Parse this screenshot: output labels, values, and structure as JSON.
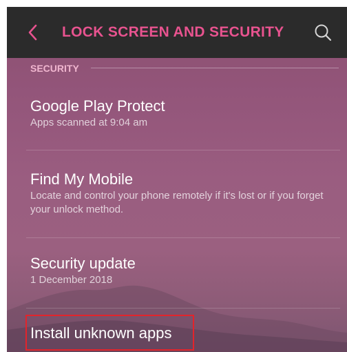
{
  "header": {
    "back_label": "<",
    "title": "LOCK SCREEN AND SECURITY"
  },
  "section": {
    "label": "SECURITY"
  },
  "items": [
    {
      "title": "Google Play Protect",
      "subtitle": "Apps scanned at 9:04 am"
    },
    {
      "title": "Find My Mobile",
      "subtitle": "Locate and control your phone remotely if it's lost or if you forget your unlock method."
    },
    {
      "title": "Security update",
      "subtitle": "1 December 2018"
    },
    {
      "title": "Install unknown apps"
    }
  ],
  "colors": {
    "accent": "#e8538f",
    "topbar": "#2b2b2b",
    "highlight_border": "#e3242b"
  },
  "icons": {
    "back": "chevron-left-icon",
    "search": "search-icon"
  }
}
